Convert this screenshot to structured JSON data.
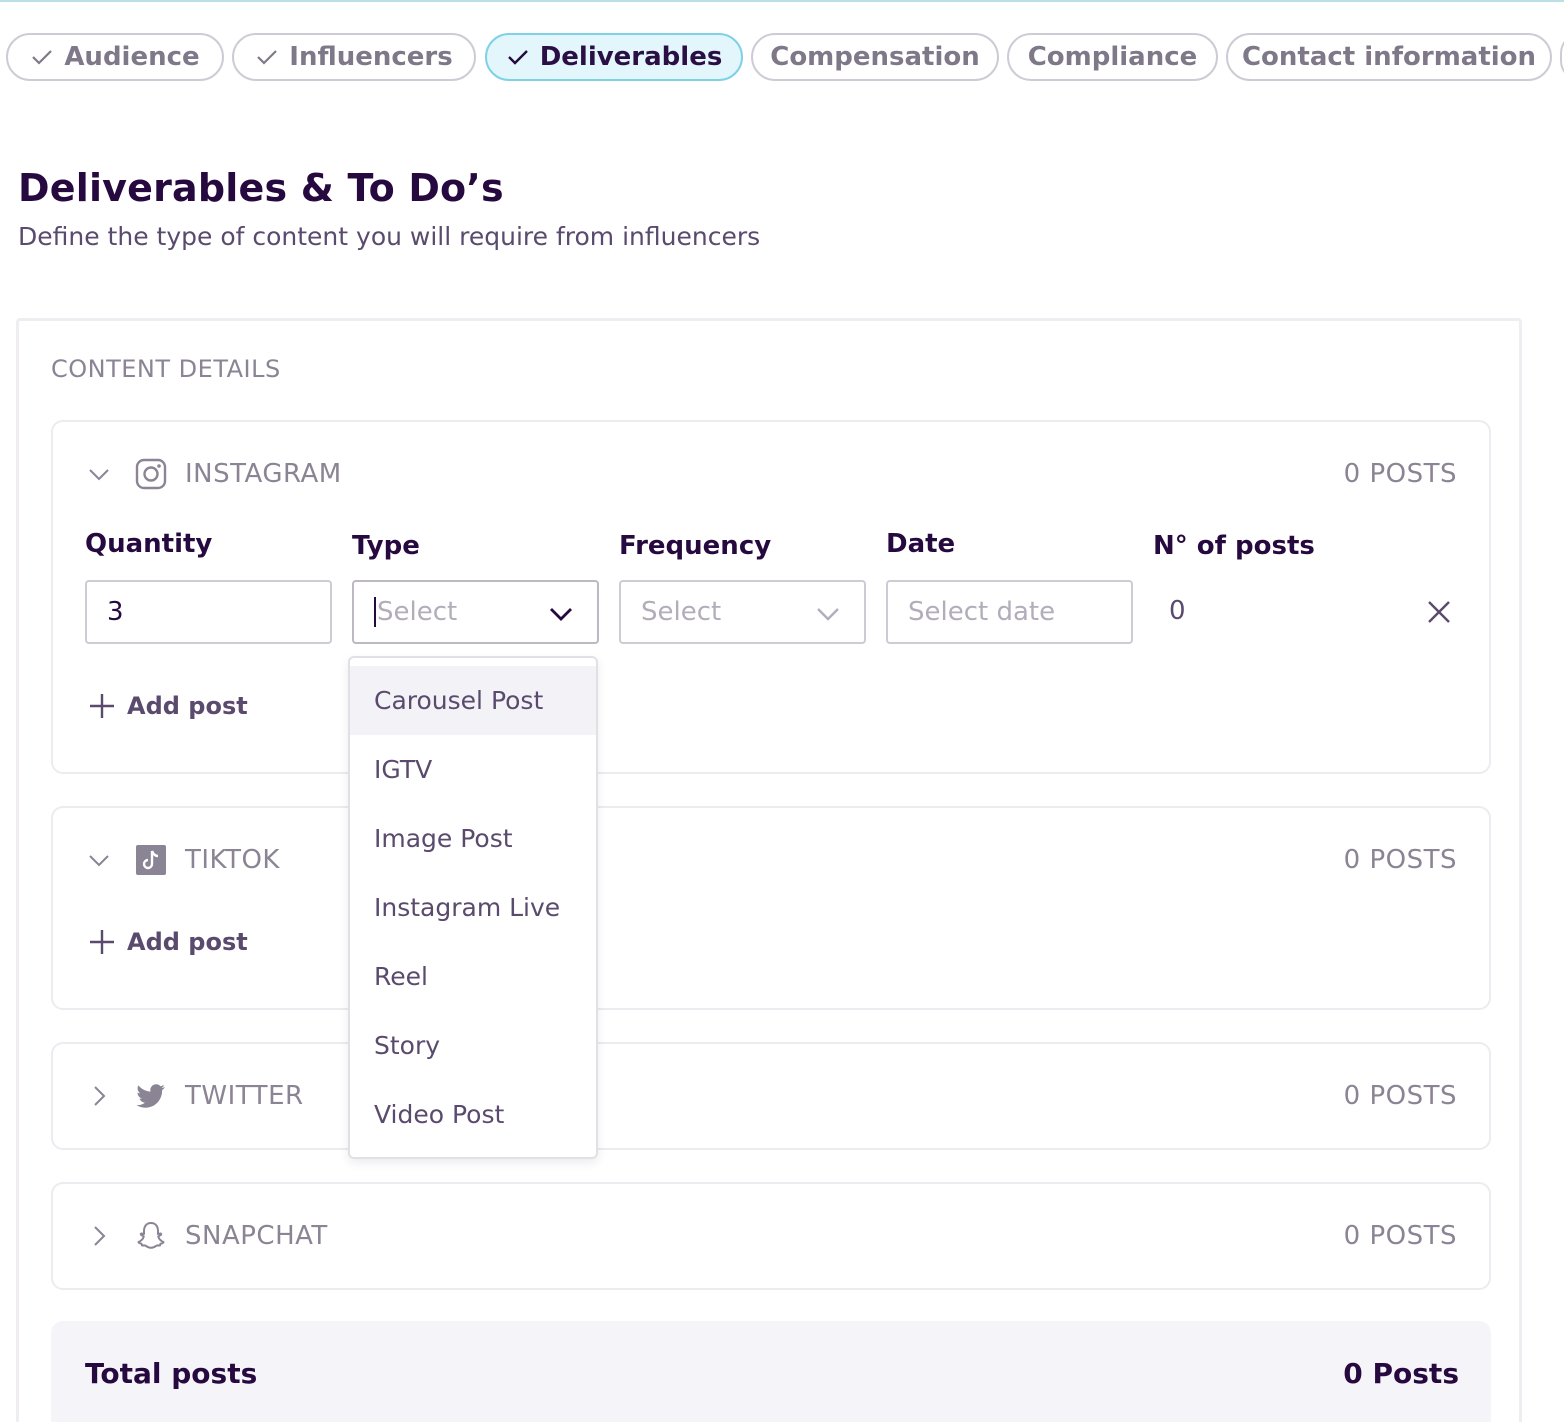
{
  "steps": [
    {
      "label": "Audience",
      "done": true
    },
    {
      "label": "Influencers",
      "done": true
    },
    {
      "label": "Deliverables",
      "done": true,
      "active": true
    },
    {
      "label": "Compensation",
      "done": false
    },
    {
      "label": "Compliance",
      "done": false
    },
    {
      "label": "Contact information",
      "done": false
    }
  ],
  "page": {
    "title": "Deliverables & To Do’s",
    "subtitle": "Define the type of content you will require from influencers"
  },
  "content": {
    "section_label": "CONTENT DETAILS",
    "columns": {
      "quantity": "Quantity",
      "type": "Type",
      "frequency": "Frequency",
      "date": "Date",
      "nposts": "N° of posts"
    },
    "add_post_label": "Add post",
    "platforms": [
      {
        "name": "INSTAGRAM",
        "count": "0 POSTS",
        "expanded": true,
        "icon": "instagram-icon"
      },
      {
        "name": "TIKTOK",
        "count": "0 POSTS",
        "expanded": true,
        "icon": "tiktok-icon"
      },
      {
        "name": "TWITTER",
        "count": "0 POSTS",
        "expanded": false,
        "icon": "twitter-icon"
      },
      {
        "name": "SNAPCHAT",
        "count": "0 POSTS",
        "expanded": false,
        "icon": "snapchat-icon"
      }
    ],
    "instagram_row": {
      "quantity": "3",
      "type_placeholder": "Select",
      "frequency_placeholder": "Select",
      "date_placeholder": "Select date",
      "nposts": "0"
    },
    "type_options": [
      "Carousel Post",
      "IGTV",
      "Image Post",
      "Instagram Live",
      "Reel",
      "Story",
      "Video Post"
    ],
    "total": {
      "label": "Total posts",
      "value": "0 Posts"
    }
  },
  "colors": {
    "primary_text": "#26093f",
    "muted": "#8a8494",
    "active_tab_bg": "#e3f6fb",
    "active_tab_border": "#7fd1e6"
  }
}
